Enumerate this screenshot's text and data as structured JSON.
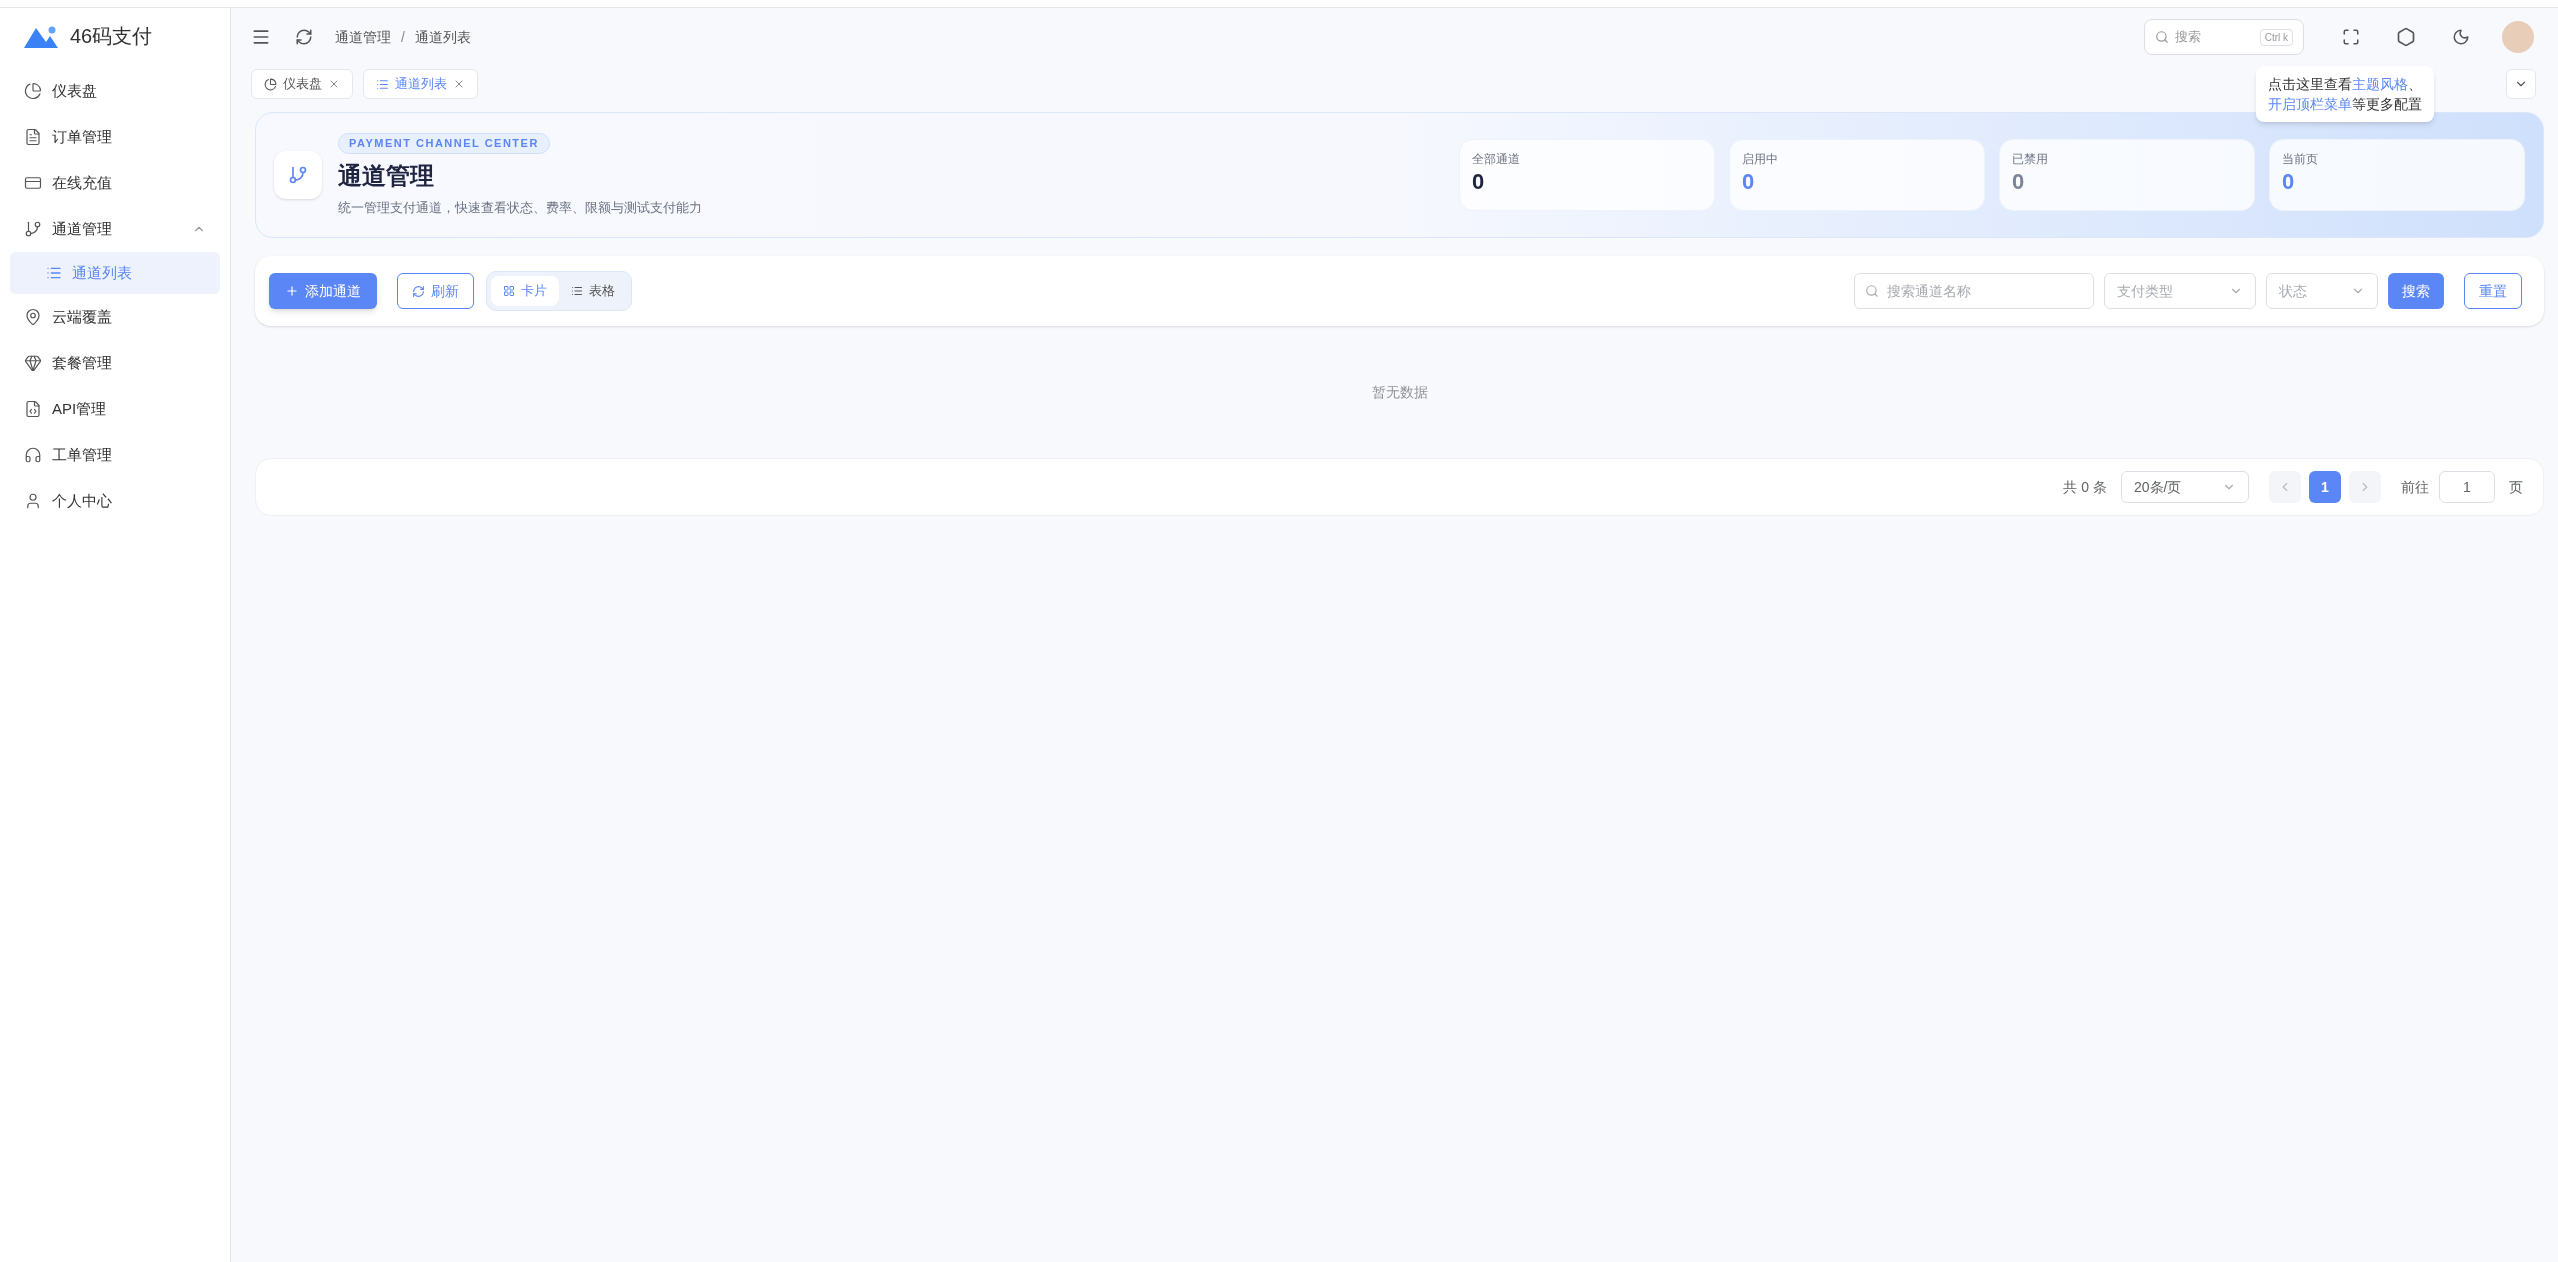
{
  "logo": {
    "text": "46码支付"
  },
  "sidebar": {
    "items": [
      {
        "label": "仪表盘",
        "selected": false
      },
      {
        "label": "订单管理",
        "selected": false
      },
      {
        "label": "在线充值",
        "selected": false
      },
      {
        "label": "通道管理",
        "selected": false,
        "expanded": true,
        "children": [
          {
            "label": "通道列表",
            "selected": true
          }
        ]
      },
      {
        "label": "云端覆盖",
        "selected": false
      },
      {
        "label": "套餐管理",
        "selected": false
      },
      {
        "label": "API管理",
        "selected": false
      },
      {
        "label": "工单管理",
        "selected": false
      },
      {
        "label": "个人中心",
        "selected": false
      }
    ]
  },
  "header": {
    "breadcrumb": [
      "通道管理",
      "通道列表"
    ],
    "separator": "/",
    "search": {
      "placeholder": "搜索",
      "shortcut": "Ctrl k"
    }
  },
  "tooltip": {
    "lines": [
      [
        {
          "text": "点击这里查看",
          "link": false
        },
        {
          "text": "主题风格",
          "link": true
        },
        {
          "text": "、",
          "link": false
        }
      ],
      [
        {
          "text": "开启顶栏菜单",
          "link": true
        },
        {
          "text": "等更多配置",
          "link": false
        }
      ]
    ]
  },
  "tabs": [
    {
      "label": "仪表盘",
      "selected": false
    },
    {
      "label": "通道列表",
      "selected": true
    }
  ],
  "banner": {
    "tag": "PAYMENT CHANNEL CENTER",
    "title": "通道管理",
    "subtitle": "统一管理支付通道，快速查看状态、费率、限额与测试支付能力",
    "stats": [
      {
        "label": "全部通道",
        "value": "0",
        "color": "#1f2440"
      },
      {
        "label": "启用中",
        "value": "0",
        "color": "#5b86f5"
      },
      {
        "label": "已禁用",
        "value": "0",
        "color": "#7b8499"
      },
      {
        "label": "当前页",
        "value": "0",
        "color": "#5b86f5"
      }
    ]
  },
  "toolbar": {
    "add_button": "添加通道",
    "refresh_button": "刷新",
    "views": [
      {
        "label": "卡片",
        "selected": true
      },
      {
        "label": "表格",
        "selected": false
      }
    ],
    "search": {
      "placeholder": "搜索通道名称"
    },
    "selects": [
      {
        "placeholder": "支付类型"
      },
      {
        "placeholder": "状态"
      }
    ],
    "search_button": "搜索",
    "reset_button": "重置"
  },
  "empty": "暂无数据",
  "pagination": {
    "total": "共 0 条",
    "page_size": "20条/页",
    "pages": [
      {
        "label": "1",
        "selected": true
      }
    ],
    "goto_label": "前往",
    "goto_value": "1",
    "suffix": "页"
  }
}
